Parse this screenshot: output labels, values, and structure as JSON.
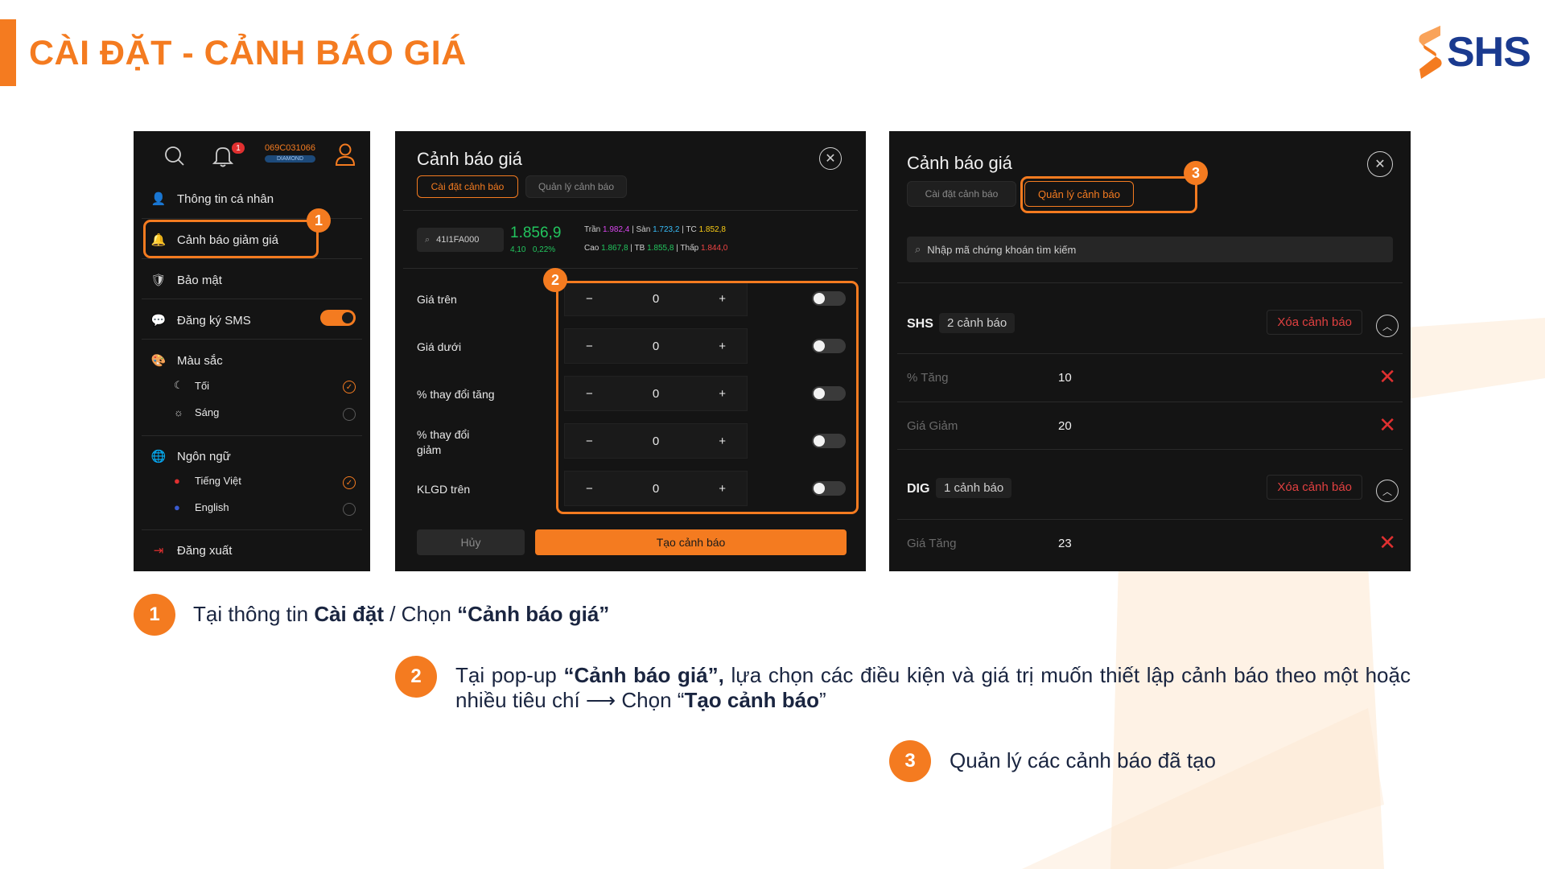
{
  "header": {
    "title": "CÀI ĐẶT - CẢNH BÁO GIÁ",
    "logo_text": "SHS"
  },
  "colors": {
    "accent": "#f47b20",
    "brand_blue": "#1a3a8f",
    "panel_bg": "#141414",
    "danger": "#e03030"
  },
  "panel1": {
    "notif_count": "1",
    "account_id": "069C031066",
    "account_tier": "DIAMOND",
    "menu": {
      "profile": "Thông tin cá nhân",
      "price_alert": "Cảnh báo giảm giá",
      "security": "Bảo mật",
      "sms": "Đăng ký SMS",
      "color": "Màu sắc",
      "dark": "Tối",
      "light": "Sáng",
      "language": "Ngôn ngữ",
      "vietnamese": "Tiếng Việt",
      "english": "English",
      "logout": "Đăng xuất"
    }
  },
  "panel2": {
    "title": "Cảnh báo giá",
    "tab_setup": "Cài đặt cảnh báo",
    "tab_manage": "Quản lý cảnh báo",
    "symbol": "41I1FA000",
    "price": "1.856,9",
    "change": "4,10",
    "change_pct": "0,22%",
    "ref": {
      "ceil_label": "Trần",
      "ceil": "1.982,4",
      "floor_label": "Sàn",
      "floor": "1.723,2",
      "tc_label": "TC",
      "tc": "1.852,8",
      "high_label": "Cao",
      "high": "1.867,8",
      "avg_label": "TB",
      "avg": "1.855,8",
      "low_label": "Thấp",
      "low": "1.844,0"
    },
    "rows": [
      {
        "label": "Giá trên",
        "value": "0"
      },
      {
        "label": "Giá dưới",
        "value": "0"
      },
      {
        "label": "% thay đổi tăng",
        "value": "0"
      },
      {
        "label": "% thay đổi giảm",
        "value": "0"
      },
      {
        "label": "KLGD trên",
        "value": "0"
      }
    ],
    "minus": "−",
    "plus": "+",
    "cancel": "Hủy",
    "create": "Tạo cảnh báo"
  },
  "panel3": {
    "title": "Cảnh báo giá",
    "tab_setup": "Cài đặt cảnh báo",
    "tab_manage": "Quản lý cảnh báo",
    "search_placeholder": "Nhập mã chứng khoán tìm kiếm",
    "groups": [
      {
        "symbol": "SHS",
        "count": "2 cảnh báo",
        "delete": "Xóa cảnh báo"
      },
      {
        "symbol": "DIG",
        "count": "1 cảnh báo",
        "delete": "Xóa cảnh báo"
      }
    ],
    "alerts": [
      {
        "label": "% Tăng",
        "value": "10"
      },
      {
        "label": "Giá Giảm",
        "value": "20"
      },
      {
        "label": "Giá Tăng",
        "value": "23"
      }
    ]
  },
  "callouts": [
    "1",
    "2",
    "3"
  ],
  "steps": [
    {
      "num": "1",
      "t1": "Tại thông tin ",
      "b1": "Cài đặt",
      "t2": " / Chọn ",
      "b2": "“Cảnh báo giá”",
      "t3": ""
    },
    {
      "num": "2",
      "t1": "Tại pop-up ",
      "b1": "“Cảnh báo giá”,",
      "t2": " lựa chọn các điều kiện và giá trị muốn thiết lập cảnh báo theo một hoặc nhiều tiêu chí ⟶ Chọn “",
      "b2": "Tạo cảnh báo",
      "t3": "”"
    },
    {
      "num": "3",
      "t1": "Quản lý các cảnh báo đã tạo",
      "b1": "",
      "t2": "",
      "b2": "",
      "t3": ""
    }
  ]
}
